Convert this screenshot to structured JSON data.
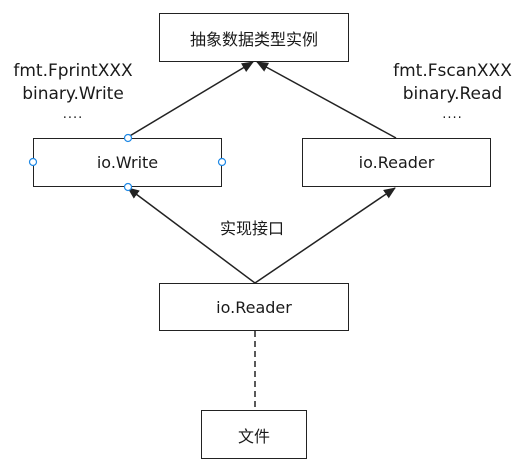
{
  "nodes": {
    "abstract": {
      "label": "抽象数据类型实例"
    },
    "io_write": {
      "label": "io.Write"
    },
    "io_reader_right": {
      "label": "io.Reader"
    },
    "io_reader_bottom": {
      "label": "io.Reader"
    },
    "file": {
      "label": "文件"
    }
  },
  "annotations": {
    "left": {
      "line1": "fmt.FprintXXX",
      "line2": "binary.Write",
      "line3": "...."
    },
    "right": {
      "line1": "fmt.FscanXXX",
      "line2": "binary.Read",
      "line3": "...."
    },
    "implements": "实现接口"
  },
  "colors": {
    "stroke": "#222222",
    "handle": "#1e88e5"
  }
}
